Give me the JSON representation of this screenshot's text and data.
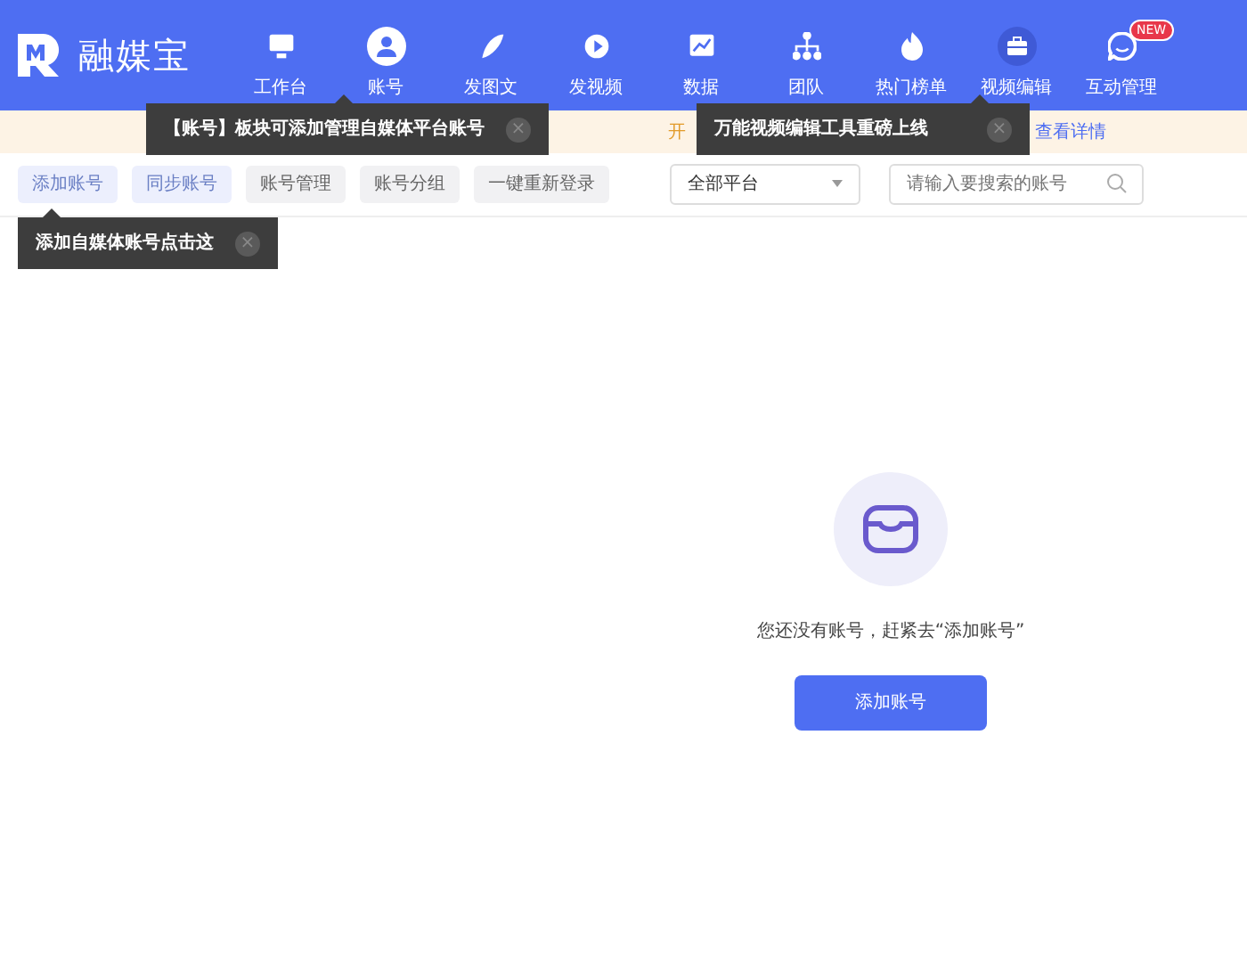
{
  "header": {
    "logo_text": "融媒宝",
    "nav": [
      {
        "label": "工作台",
        "selected": false,
        "highlighted": false
      },
      {
        "label": "账号",
        "selected": true,
        "highlighted": false
      },
      {
        "label": "发图文",
        "selected": false,
        "highlighted": false
      },
      {
        "label": "发视频",
        "selected": false,
        "highlighted": false
      },
      {
        "label": "数据",
        "selected": false,
        "highlighted": false
      },
      {
        "label": "团队",
        "selected": false,
        "highlighted": false
      },
      {
        "label": "热门榜单",
        "selected": false,
        "highlighted": false
      },
      {
        "label": "视频编辑",
        "selected": false,
        "highlighted": true
      },
      {
        "label": "互动管理",
        "selected": false,
        "highlighted": false,
        "badge": "NEW"
      }
    ]
  },
  "notice_bar": {
    "text": "开",
    "link": "查看详情"
  },
  "toolbar": {
    "buttons": [
      {
        "label": "添加账号",
        "primary": true
      },
      {
        "label": "同步账号",
        "primary": true
      },
      {
        "label": "账号管理",
        "primary": false
      },
      {
        "label": "账号分组",
        "primary": false
      },
      {
        "label": "一键重新登录",
        "primary": false
      }
    ],
    "platform_select": "全部平台",
    "search": {
      "placeholder": "请输入要搜索的账号"
    }
  },
  "tooltips": [
    {
      "text": "【账号】板块可添加管理自媒体平台账号",
      "close": "×"
    },
    {
      "text": "万能视频编辑工具重磅上线",
      "close": "×"
    },
    {
      "text": "添加自媒体账号点击这",
      "close": "×"
    }
  ],
  "empty_state": {
    "message": "您还没有账号，赶紧去“添加账号”",
    "button": "添加账号"
  }
}
